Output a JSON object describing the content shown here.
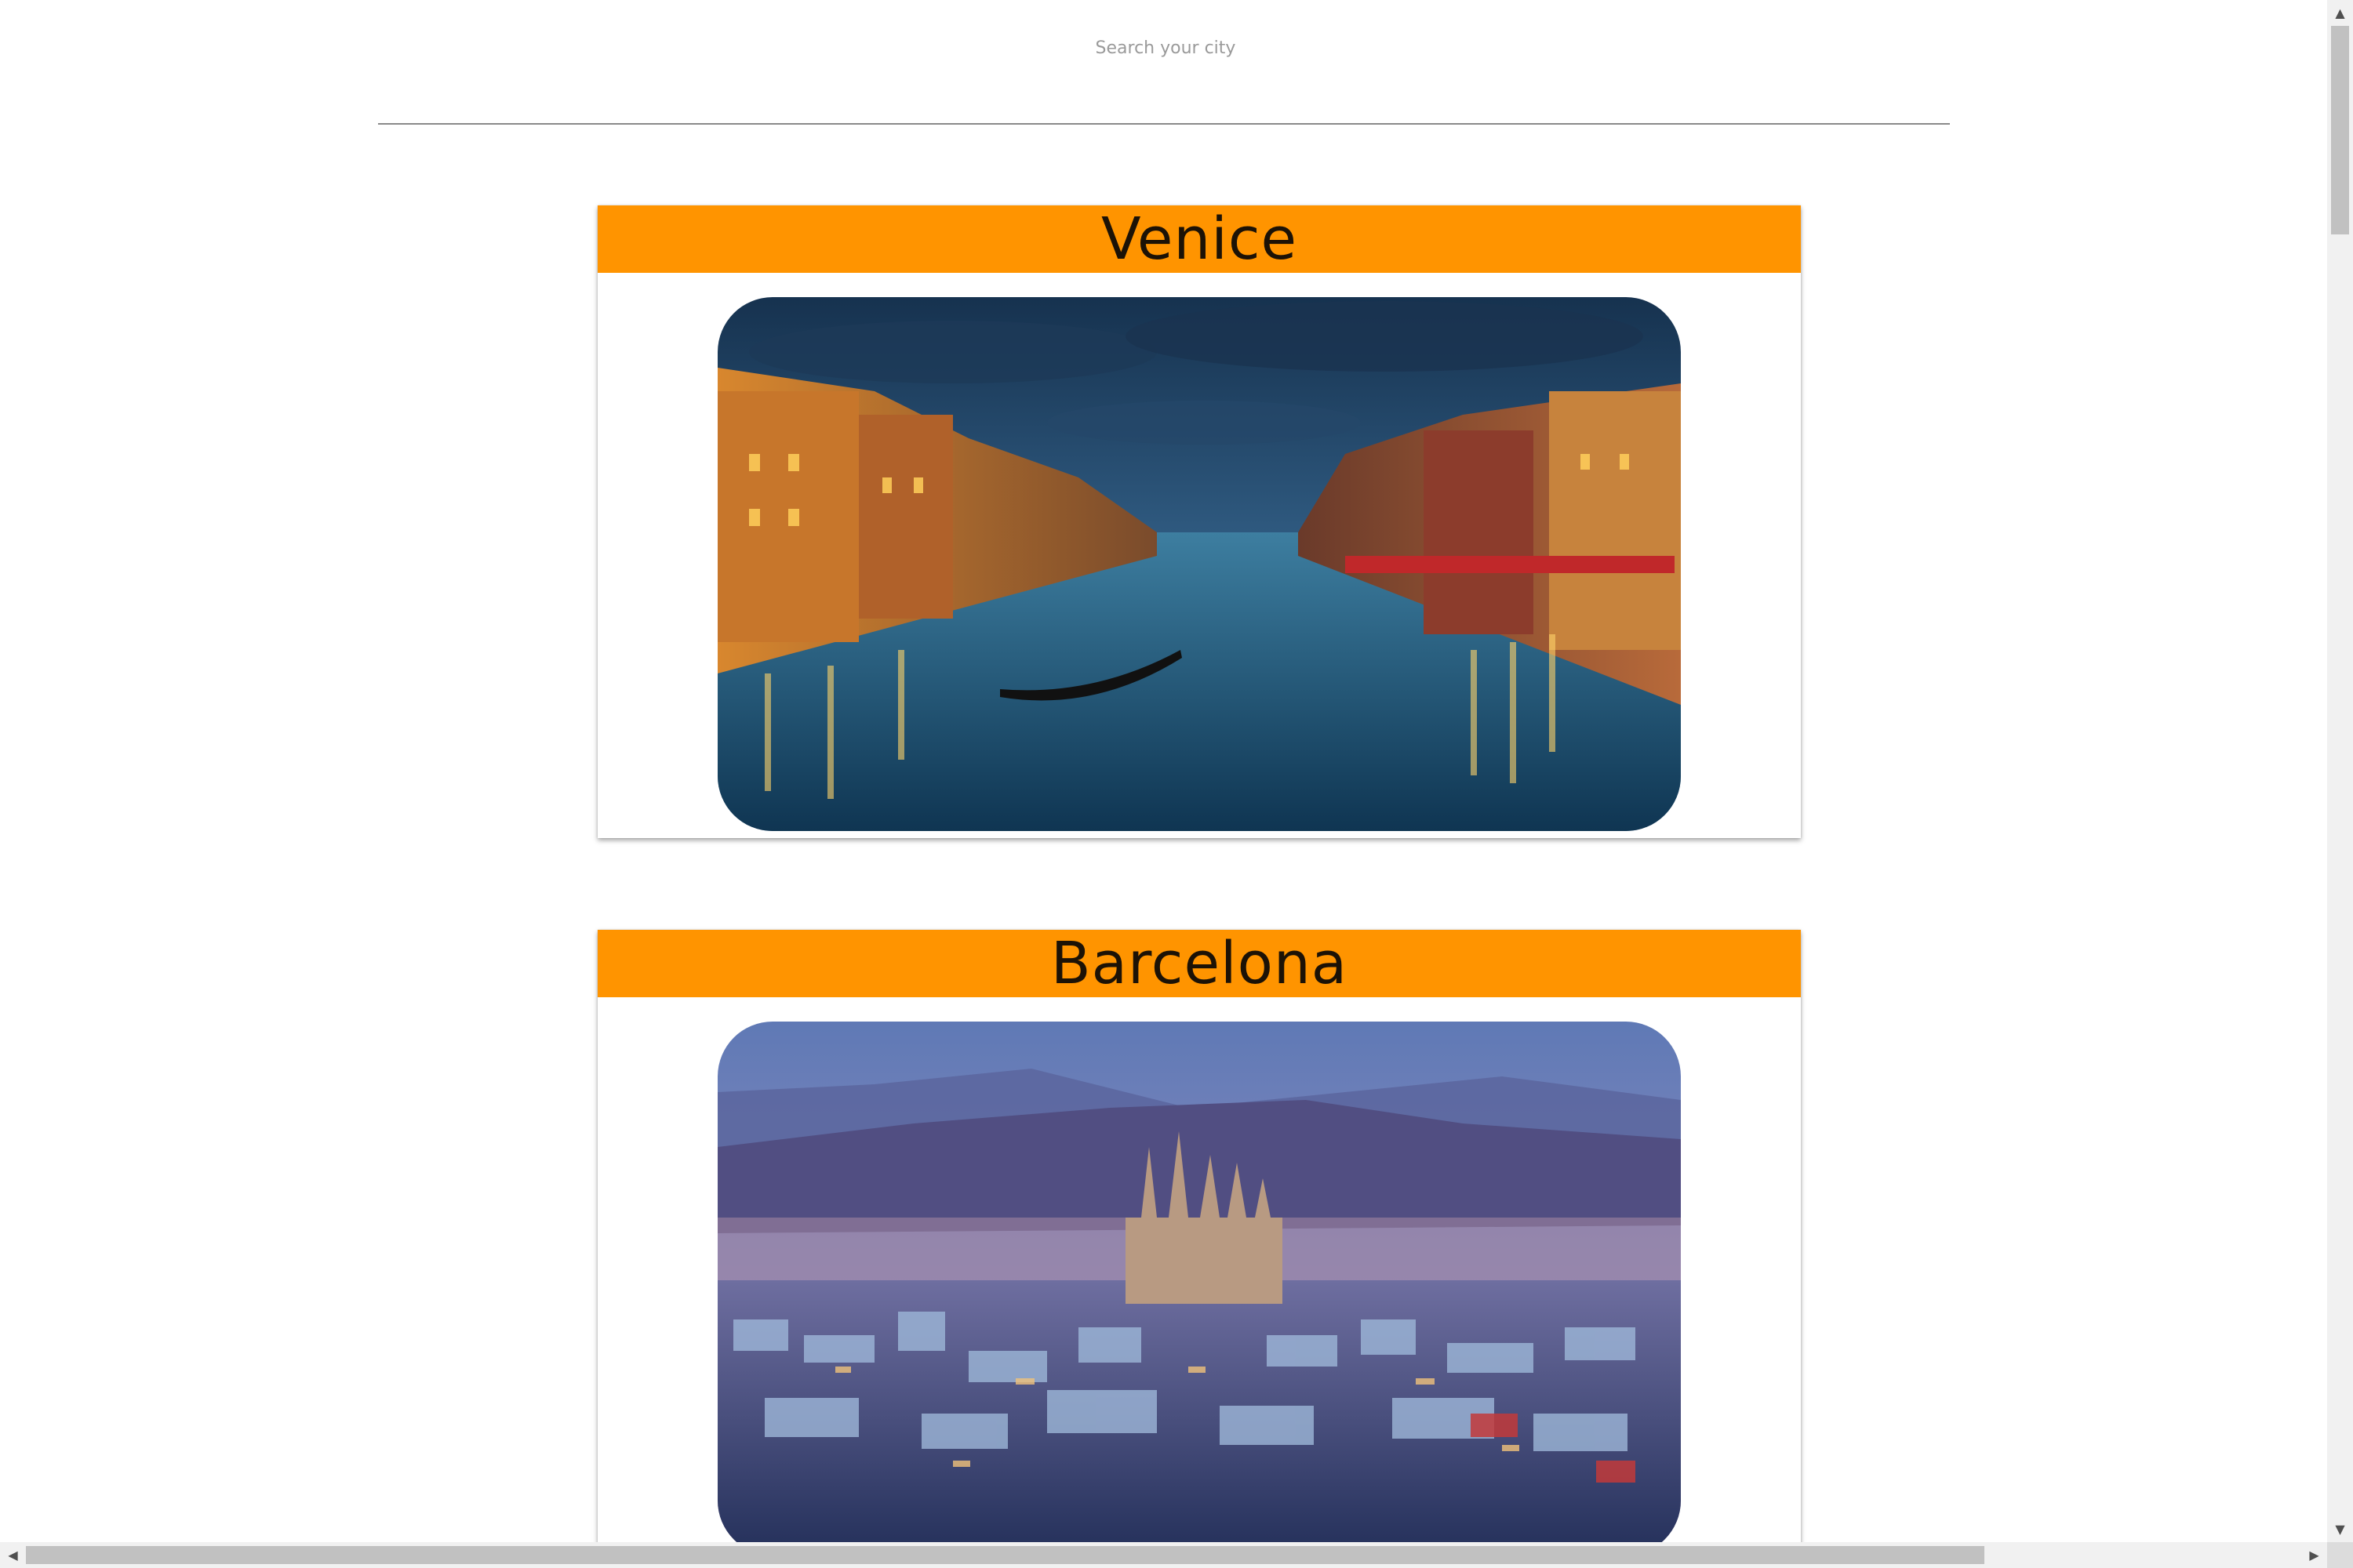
{
  "search": {
    "placeholder": "Search your city",
    "value": ""
  },
  "cities": [
    {
      "name": "Venice",
      "image": "venice-grand-canal-night-photo"
    },
    {
      "name": "Barcelona",
      "image": "barcelona-city-skyline-dusk-photo"
    }
  ],
  "colors": {
    "card_header": "#ff9400",
    "title_text": "#1c1206",
    "divider": "#8a8a8a"
  },
  "icons": {
    "scroll_up": "▲",
    "scroll_down": "▼",
    "scroll_left": "◀",
    "scroll_right": "▶"
  }
}
